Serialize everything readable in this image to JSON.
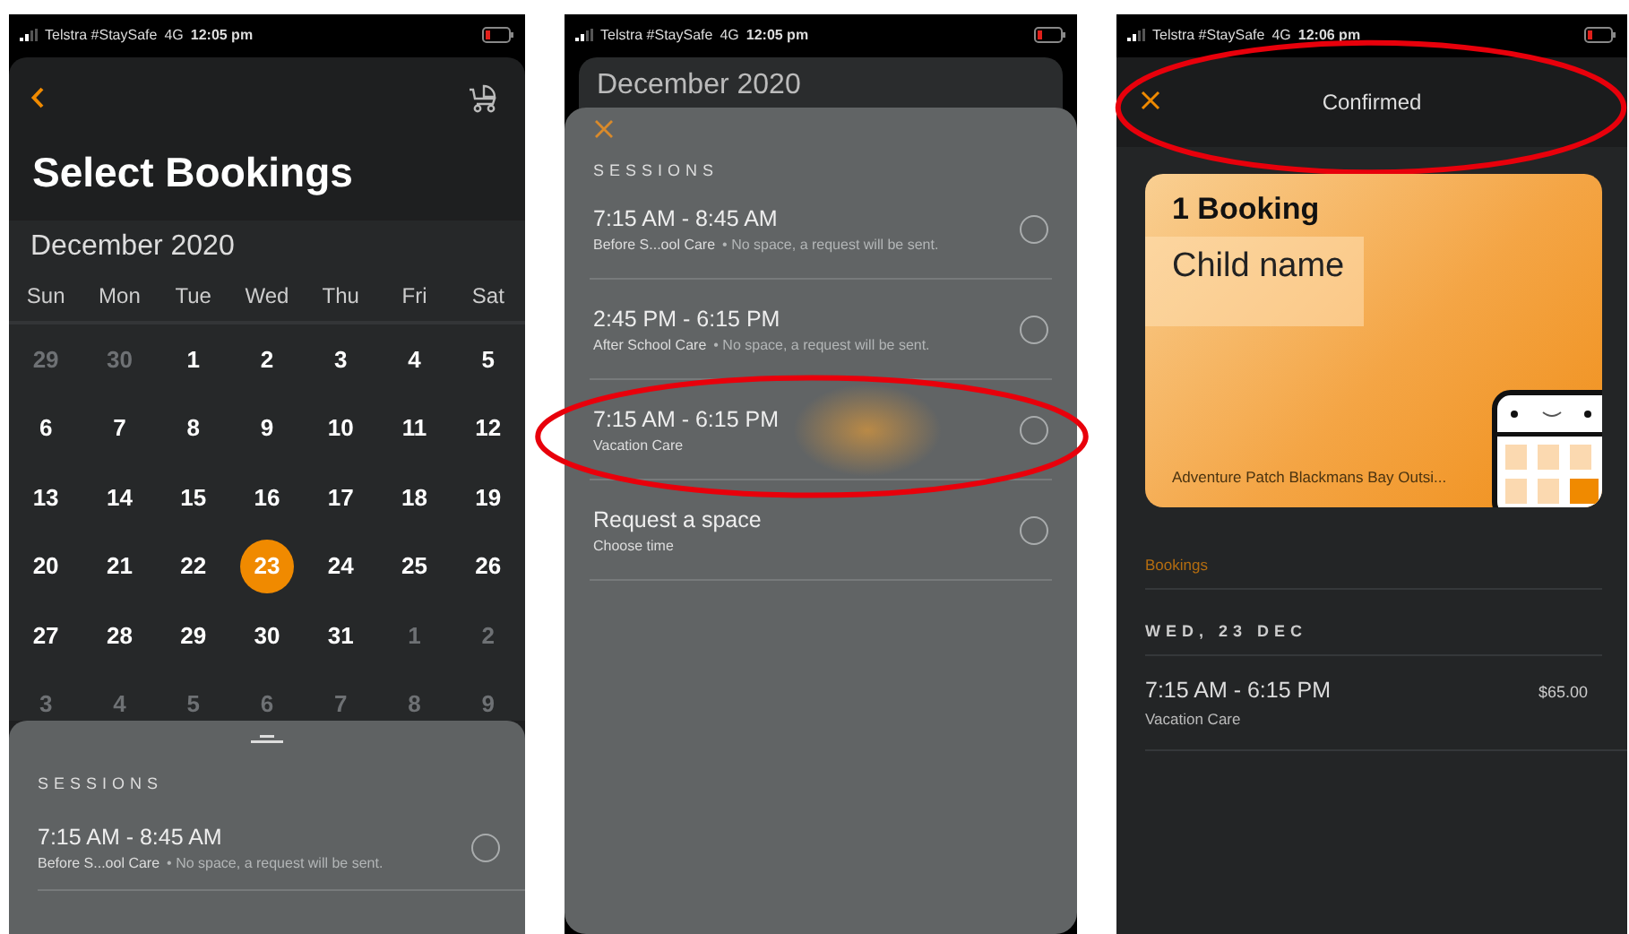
{
  "screens": [
    {
      "kind": "calendar",
      "status_bar": {
        "carrier": "Telstra #StaySafe",
        "network": "4G",
        "time": "12:05 pm"
      },
      "title": "Select Bookings",
      "month": "December 2020",
      "weekdays": [
        "Sun",
        "Mon",
        "Tue",
        "Wed",
        "Thu",
        "Fri",
        "Sat"
      ],
      "weeks": [
        [
          {
            "label": "29",
            "in_month": false,
            "selected": false
          },
          {
            "label": "30",
            "in_month": false,
            "selected": false
          },
          {
            "label": "1",
            "in_month": true,
            "selected": false
          },
          {
            "label": "2",
            "in_month": true,
            "selected": false
          },
          {
            "label": "3",
            "in_month": true,
            "selected": false
          },
          {
            "label": "4",
            "in_month": true,
            "selected": false
          },
          {
            "label": "5",
            "in_month": true,
            "selected": false
          }
        ],
        [
          {
            "label": "6",
            "in_month": true,
            "selected": false
          },
          {
            "label": "7",
            "in_month": true,
            "selected": false
          },
          {
            "label": "8",
            "in_month": true,
            "selected": false
          },
          {
            "label": "9",
            "in_month": true,
            "selected": false
          },
          {
            "label": "10",
            "in_month": true,
            "selected": false
          },
          {
            "label": "11",
            "in_month": true,
            "selected": false
          },
          {
            "label": "12",
            "in_month": true,
            "selected": false
          }
        ],
        [
          {
            "label": "13",
            "in_month": true,
            "selected": false
          },
          {
            "label": "14",
            "in_month": true,
            "selected": false
          },
          {
            "label": "15",
            "in_month": true,
            "selected": false
          },
          {
            "label": "16",
            "in_month": true,
            "selected": false
          },
          {
            "label": "17",
            "in_month": true,
            "selected": false
          },
          {
            "label": "18",
            "in_month": true,
            "selected": false
          },
          {
            "label": "19",
            "in_month": true,
            "selected": false
          }
        ],
        [
          {
            "label": "20",
            "in_month": true,
            "selected": false
          },
          {
            "label": "21",
            "in_month": true,
            "selected": false
          },
          {
            "label": "22",
            "in_month": true,
            "selected": false
          },
          {
            "label": "23",
            "in_month": true,
            "selected": true
          },
          {
            "label": "24",
            "in_month": true,
            "selected": false
          },
          {
            "label": "25",
            "in_month": true,
            "selected": false
          },
          {
            "label": "26",
            "in_month": true,
            "selected": false
          }
        ],
        [
          {
            "label": "27",
            "in_month": true,
            "selected": false
          },
          {
            "label": "28",
            "in_month": true,
            "selected": false
          },
          {
            "label": "29",
            "in_month": true,
            "selected": false
          },
          {
            "label": "30",
            "in_month": true,
            "selected": false
          },
          {
            "label": "31",
            "in_month": true,
            "selected": false
          },
          {
            "label": "1",
            "in_month": false,
            "selected": false
          },
          {
            "label": "2",
            "in_month": false,
            "selected": false
          }
        ],
        [
          {
            "label": "3",
            "in_month": false,
            "selected": false
          },
          {
            "label": "4",
            "in_month": false,
            "selected": false
          },
          {
            "label": "5",
            "in_month": false,
            "selected": false
          },
          {
            "label": "6",
            "in_month": false,
            "selected": false
          },
          {
            "label": "7",
            "in_month": false,
            "selected": false
          },
          {
            "label": "8",
            "in_month": false,
            "selected": false
          },
          {
            "label": "9",
            "in_month": false,
            "selected": false
          }
        ]
      ],
      "sessions_heading": "SESSIONS",
      "sessions": [
        {
          "title": "7:15 AM - 8:45 AM",
          "subtitle": "Before S...ool Care",
          "note": "• No space, a request will be sent.",
          "selected": false
        }
      ]
    },
    {
      "kind": "sessions",
      "status_bar": {
        "carrier": "Telstra #StaySafe",
        "network": "4G",
        "time": "12:05 pm"
      },
      "month": "December 2020",
      "sessions_heading": "SESSIONS",
      "sessions": [
        {
          "title": "7:15 AM - 8:45 AM",
          "subtitle": "Before S...ool Care",
          "note": "• No space, a request will be sent.",
          "selected": false,
          "pressed": false,
          "highlighted": false
        },
        {
          "title": "2:45 PM - 6:15 PM",
          "subtitle": "After School Care",
          "note": "• No space, a request will be sent.",
          "selected": false,
          "pressed": false,
          "highlighted": false
        },
        {
          "title": "7:15 AM - 6:15 PM",
          "subtitle": "Vacation Care",
          "selected": false,
          "pressed": true,
          "highlighted": true
        },
        {
          "title": "Request a space",
          "subtitle": "Choose time",
          "selected": false,
          "pressed": false,
          "highlighted": false
        }
      ]
    },
    {
      "kind": "confirmation",
      "status_bar": {
        "carrier": "Telstra #StaySafe",
        "network": "4G",
        "time": "12:06 pm"
      },
      "header": {
        "title": "Confirmed",
        "highlighted": true
      },
      "card": {
        "count": "1 Booking",
        "child": "Child name",
        "location": "Adventure Patch Blackmans Bay Outsi..."
      },
      "section_label": "Bookings",
      "date": "WED, 23 DEC",
      "bookings": [
        {
          "time": "7:15 AM - 6:15 PM",
          "name": "Vacation Care",
          "price": "$65.00"
        }
      ]
    }
  ]
}
